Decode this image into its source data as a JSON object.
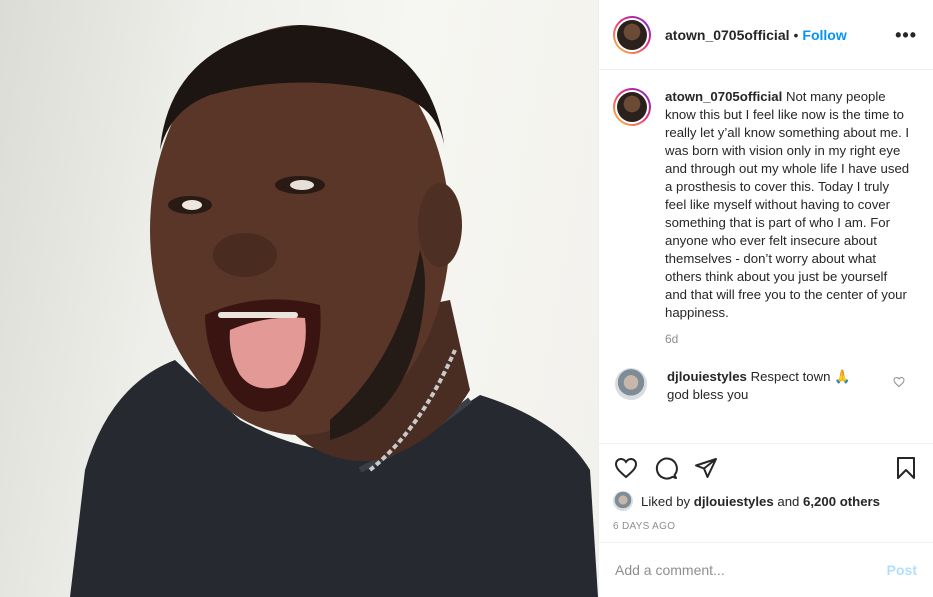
{
  "post": {
    "photo_icon": "portrait-photo"
  },
  "header": {
    "username": "atown_0705official",
    "separator": "•",
    "follow_label": "Follow",
    "more_icon": "more-horizontal-icon",
    "more_label": "•••"
  },
  "caption": {
    "username": "atown_0705official",
    "text": "Not many people know this but I feel like now is the time to really let y’all know something about me. I was born with vision only in my right eye and through out my whole life I have used a prosthesis to cover this. Today I truly feel like myself without having to cover something that is part of who I am. For anyone who ever felt insecure about themselves - don’t worry about what others think about you just be yourself and that will free you to the center of your happiness.",
    "time": "6d"
  },
  "comments": [
    {
      "username": "djlouiestyles",
      "text": "Respect town 🙏 god bless you"
    }
  ],
  "actions": {
    "icons": [
      "heart-icon",
      "comment-icon",
      "share-icon",
      "bookmark-icon"
    ],
    "liked_by_prefix": "Liked by",
    "liked_by_user": "djlouiestyles",
    "liked_by_join": "and",
    "liked_by_others": "6,200 others",
    "posted_ago": "6 DAYS AGO"
  },
  "add_comment": {
    "placeholder": "Add a comment...",
    "post_label": "Post"
  },
  "colors": {
    "link_blue": "#0095f6",
    "post_disabled": "#b2dffc",
    "muted": "#8e8e8e",
    "text": "#262626"
  }
}
